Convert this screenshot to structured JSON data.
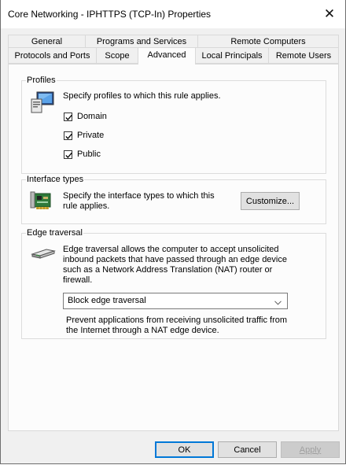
{
  "window": {
    "title": "Core Networking - IPHTTPS (TCP-In) Properties",
    "close_glyph": "✕"
  },
  "tabs": {
    "row1": [
      "General",
      "Programs and Services",
      "Remote Computers"
    ],
    "row2": [
      "Protocols and Ports",
      "Scope",
      "Advanced",
      "Local Principals",
      "Remote Users"
    ],
    "active": "Advanced"
  },
  "profiles": {
    "legend": "Profiles",
    "description": "Specify profiles to which this rule applies.",
    "icon": "profiles-computer-icon",
    "items": [
      {
        "label": "Domain",
        "checked": true
      },
      {
        "label": "Private",
        "checked": true
      },
      {
        "label": "Public",
        "checked": true
      }
    ]
  },
  "interface_types": {
    "legend": "Interface types",
    "description_line1": "Specify the interface types to which this",
    "description_line2": "rule applies.",
    "icon": "network-card-icon",
    "customize_label": "Customize..."
  },
  "edge_traversal": {
    "legend": "Edge traversal",
    "icon": "edge-router-icon",
    "description_lines": [
      "Edge traversal allows the computer to accept unsolicited",
      "inbound packets that have passed through an edge device",
      "such as a Network Address Translation (NAT) router or",
      "firewall."
    ],
    "selected_option": "Block edge traversal",
    "help_line1": "Prevent applications from receiving unsolicited traffic from",
    "help_line2": "the Internet through a NAT edge device."
  },
  "footer": {
    "ok_label": "OK",
    "cancel_label": "Cancel",
    "apply_label": "Apply"
  },
  "colors": {
    "dialog_bg": "#f0f0f0",
    "panel_bg": "#fcfcfc",
    "accent": "#0078d7"
  }
}
